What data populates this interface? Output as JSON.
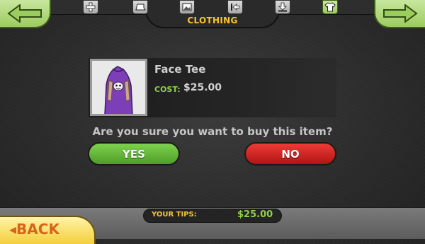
{
  "header": {
    "category_title": "CLOTHING",
    "tabs": [
      {
        "icon": "plus-icon"
      },
      {
        "icon": "hat-icon"
      },
      {
        "icon": "picture-icon"
      },
      {
        "icon": "exit-arrow-icon"
      },
      {
        "icon": "download-icon"
      },
      {
        "icon": "shirt-icon",
        "active": true
      }
    ]
  },
  "item": {
    "name": "Face Tee",
    "cost_label": "COST:",
    "cost_value": "$25.00"
  },
  "dialog": {
    "question": "Are you sure you want to buy this item?",
    "yes_label": "YES",
    "no_label": "NO"
  },
  "footer": {
    "tips_label": "YOUR TIPS:",
    "tips_value": "$25.00",
    "back_label": "◂BACK"
  },
  "colors": {
    "accent_yellow": "#f6c531",
    "accent_green": "#8fd14a",
    "yes_green": "#5fb232",
    "no_red": "#d42623",
    "back_orange": "#d5651b"
  }
}
